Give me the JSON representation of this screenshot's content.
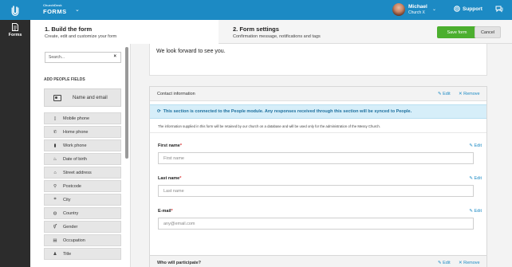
{
  "topbar": {
    "app_sub": "ChurchDesk",
    "app_name": "FORMS",
    "user_name": "Michael",
    "user_church": "Church X",
    "support_label": "Support"
  },
  "leftnav": {
    "forms_label": "Forms"
  },
  "steps": {
    "step1_title": "1. Build the form",
    "step1_sub": "Create, edit and customize your form",
    "step2_title": "2. Form settings",
    "step2_sub": "Confirmation message, notifications and tags",
    "save_label": "Save form",
    "cancel_label": "Cancel"
  },
  "sidebar": {
    "search_placeholder": "Search...",
    "search_clear": "×",
    "heading": "ADD PEOPLE FIELDS",
    "big_item": "Name and email",
    "items": [
      {
        "label": "Mobile phone",
        "icon": "phone-icon",
        "glyph": "▯"
      },
      {
        "label": "Home phone",
        "icon": "handset-icon",
        "glyph": "✆"
      },
      {
        "label": "Work phone",
        "icon": "building-icon",
        "glyph": "▮"
      },
      {
        "label": "Date of birth",
        "icon": "cake-icon",
        "glyph": "♨"
      },
      {
        "label": "Street address",
        "icon": "home-icon",
        "glyph": "⌂"
      },
      {
        "label": "Postcode",
        "icon": "pin-icon",
        "glyph": "⚲"
      },
      {
        "label": "City",
        "icon": "city-icon",
        "glyph": "⌗"
      },
      {
        "label": "Country",
        "icon": "globe-icon",
        "glyph": "◍"
      },
      {
        "label": "Gender",
        "icon": "gender-icon",
        "glyph": "⚥"
      },
      {
        "label": "Occupation",
        "icon": "briefcase-icon",
        "glyph": "▤"
      },
      {
        "label": "Title",
        "icon": "person-icon",
        "glyph": "♟"
      }
    ]
  },
  "main": {
    "intro_text": "We look forward to see you.",
    "contact_section": {
      "title": "Contact information",
      "edit_label": "Edit",
      "remove_label": "Remove",
      "notice": "This section is connected to the People module. Any responses received through this section will be synced to People.",
      "disclaimer": "The information supplied in this form will be retained by our church on a database and will be used only for the administration of the Messy Church.",
      "fields": [
        {
          "label": "First name",
          "required": "*",
          "placeholder": "First name",
          "edit": "Edit"
        },
        {
          "label": "Last name",
          "required": "*",
          "placeholder": "Last name",
          "edit": "Edit"
        },
        {
          "label": "E-mail",
          "required": "*",
          "placeholder": "any@email.com",
          "edit": "Edit"
        }
      ]
    },
    "participate_section": {
      "title": "Who will participate?",
      "edit_label": "Edit",
      "remove_label": "Remove"
    }
  },
  "colors": {
    "brand_blue": "#1c8ac4",
    "save_green": "#4caf2f",
    "nav_dark": "#2c2c2c"
  }
}
